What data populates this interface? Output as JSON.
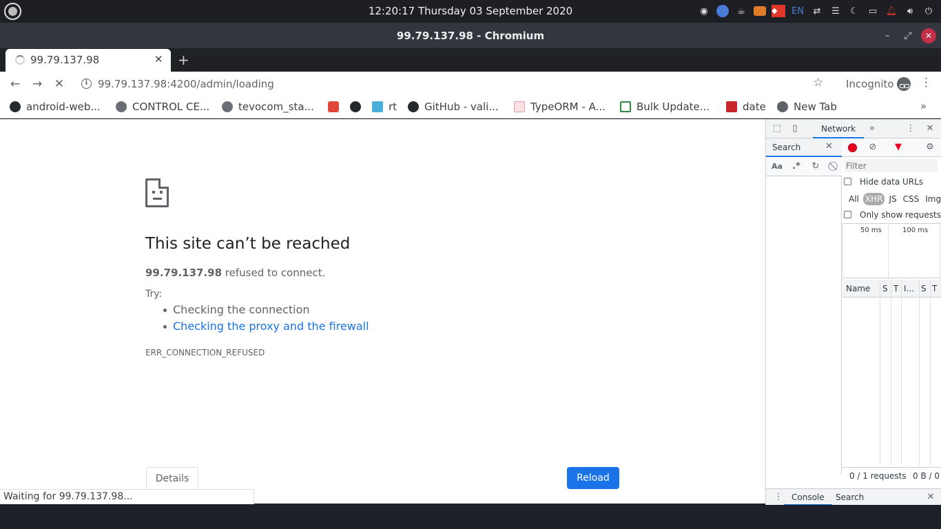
{
  "os": {
    "clock": "12:20:17  Thursday 03 September 2020",
    "language": "EN",
    "tray_icons": [
      "record-icon",
      "chromium-icon",
      "coffee-icon",
      "hammer-icon",
      "anydesk-icon",
      "language-indicator",
      "swap-icon",
      "menu-icon",
      "moon-icon",
      "folder-icon",
      "bell-icon",
      "volume-icon",
      "power-icon",
      "logout-icon"
    ]
  },
  "window": {
    "title": "99.79.137.98 - Chromium",
    "minimize": "–",
    "maximize": "⤢",
    "close": "✕"
  },
  "tab": {
    "title": "99.79.137.98",
    "close": "✕",
    "new_tab": "+"
  },
  "toolbar": {
    "back": "←",
    "forward": "→",
    "stop": "✕",
    "info": "i",
    "url": "99.79.137.98:4200/admin/loading",
    "star": "☆",
    "incognito_label": "Incognito",
    "menu": "⋮"
  },
  "bookmarks": [
    {
      "label": "android-web...",
      "icon": "github-icon"
    },
    {
      "label": "CONTROL CE...",
      "icon": "globe-icon"
    },
    {
      "label": "tevocom_sta...",
      "icon": "globe-icon"
    },
    {
      "label": "",
      "icon": "bookmark-red-icon"
    },
    {
      "label": "",
      "icon": "github-icon"
    },
    {
      "label": "rt",
      "icon": "bookmark-blue-icon"
    },
    {
      "label": "GitHub - vali...",
      "icon": "github-icon"
    },
    {
      "label": "TypeORM - A...",
      "icon": "typeorm-icon"
    },
    {
      "label": "Bulk Update...",
      "icon": "checkbox-icon"
    },
    {
      "label": "date",
      "icon": "bookmark-date-icon"
    },
    {
      "label": "New Tab",
      "icon": "new-tab-icon"
    }
  ],
  "bookmarks_more": "»",
  "error_page": {
    "heading": "This site can’t be reached",
    "host": "99.79.137.98",
    "host_suffix": " refused to connect.",
    "try_label": "Try:",
    "suggestions": [
      "Checking the connection",
      "Checking the proxy and the firewall"
    ],
    "error_code": "ERR_CONNECTION_REFUSED",
    "details_button": "Details",
    "reload_button": "Reload"
  },
  "status_bubble": "Waiting for 99.79.137.98...",
  "devtools": {
    "tab_network": "Network",
    "more_tabs": "»",
    "search_label": "Search",
    "search_close": "✕",
    "match_case": "Aa",
    "regex": ".*",
    "filter_placeholder": "Filter",
    "hide_data_urls": "Hide data URLs",
    "types": [
      "All",
      "XHR",
      "JS",
      "CSS",
      "Img"
    ],
    "only_show_requests": "Only show requests w",
    "timeline_labels": [
      "50 ms",
      "100 ms"
    ],
    "columns": [
      "Name",
      "S",
      "T",
      "I...",
      "S",
      "T"
    ],
    "requests_summary": "0 / 1 requests",
    "bytes_summary": "0 B / 0",
    "drawer_console": "Console",
    "drawer_search": "Search",
    "drawer_close": "✕"
  }
}
